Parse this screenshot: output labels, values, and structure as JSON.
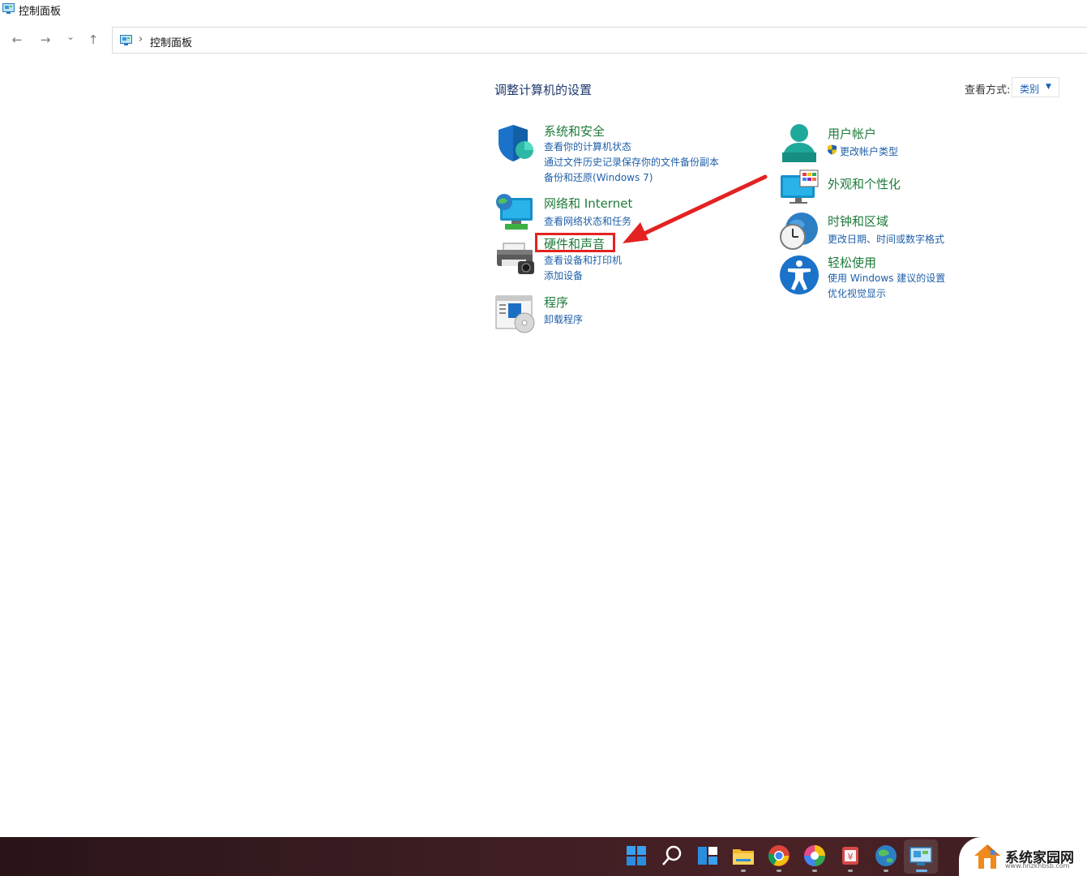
{
  "window": {
    "title": "控制面板"
  },
  "nav": {
    "back_icon": "←",
    "forward_icon": "→",
    "recent_icon": "⌄",
    "up_icon": "↑"
  },
  "address": {
    "separator": "›",
    "path": "控制面板"
  },
  "header": {
    "heading": "调整计算机的设置",
    "view_label": "查看方式:",
    "view_value": "类别"
  },
  "categories": {
    "system_security": {
      "title": "系统和安全",
      "links": [
        "查看你的计算机状态",
        "通过文件历史记录保存你的文件备份副本",
        "备份和还原(Windows 7)"
      ]
    },
    "network": {
      "title": "网络和 Internet",
      "links": [
        "查看网络状态和任务"
      ]
    },
    "hardware": {
      "title": "硬件和声音",
      "links": [
        "查看设备和打印机",
        "添加设备"
      ]
    },
    "programs": {
      "title": "程序",
      "links": [
        "卸载程序"
      ]
    },
    "user_accounts": {
      "title": "用户帐户",
      "links": [
        "更改帐户类型"
      ]
    },
    "appearance": {
      "title": "外观和个性化",
      "links": []
    },
    "clock_region": {
      "title": "时钟和区域",
      "links": [
        "更改日期、时间或数字格式"
      ]
    },
    "ease_access": {
      "title": "轻松使用",
      "links": [
        "使用 Windows 建议的设置",
        "优化视觉显示"
      ]
    }
  },
  "annotation": {
    "highlight_color": "#e32222",
    "arrow_color": "#e32222"
  },
  "taskbar": {
    "icons": [
      "windows-start-icon",
      "search-icon",
      "widgets-icon",
      "file-explorer-icon",
      "chrome-icon",
      "colorful-browser-icon",
      "app-icon",
      "earth-icon",
      "control-panel-icon"
    ]
  },
  "watermark": {
    "text": "系统家园网",
    "url": "www.hnzkhbsb.com"
  }
}
